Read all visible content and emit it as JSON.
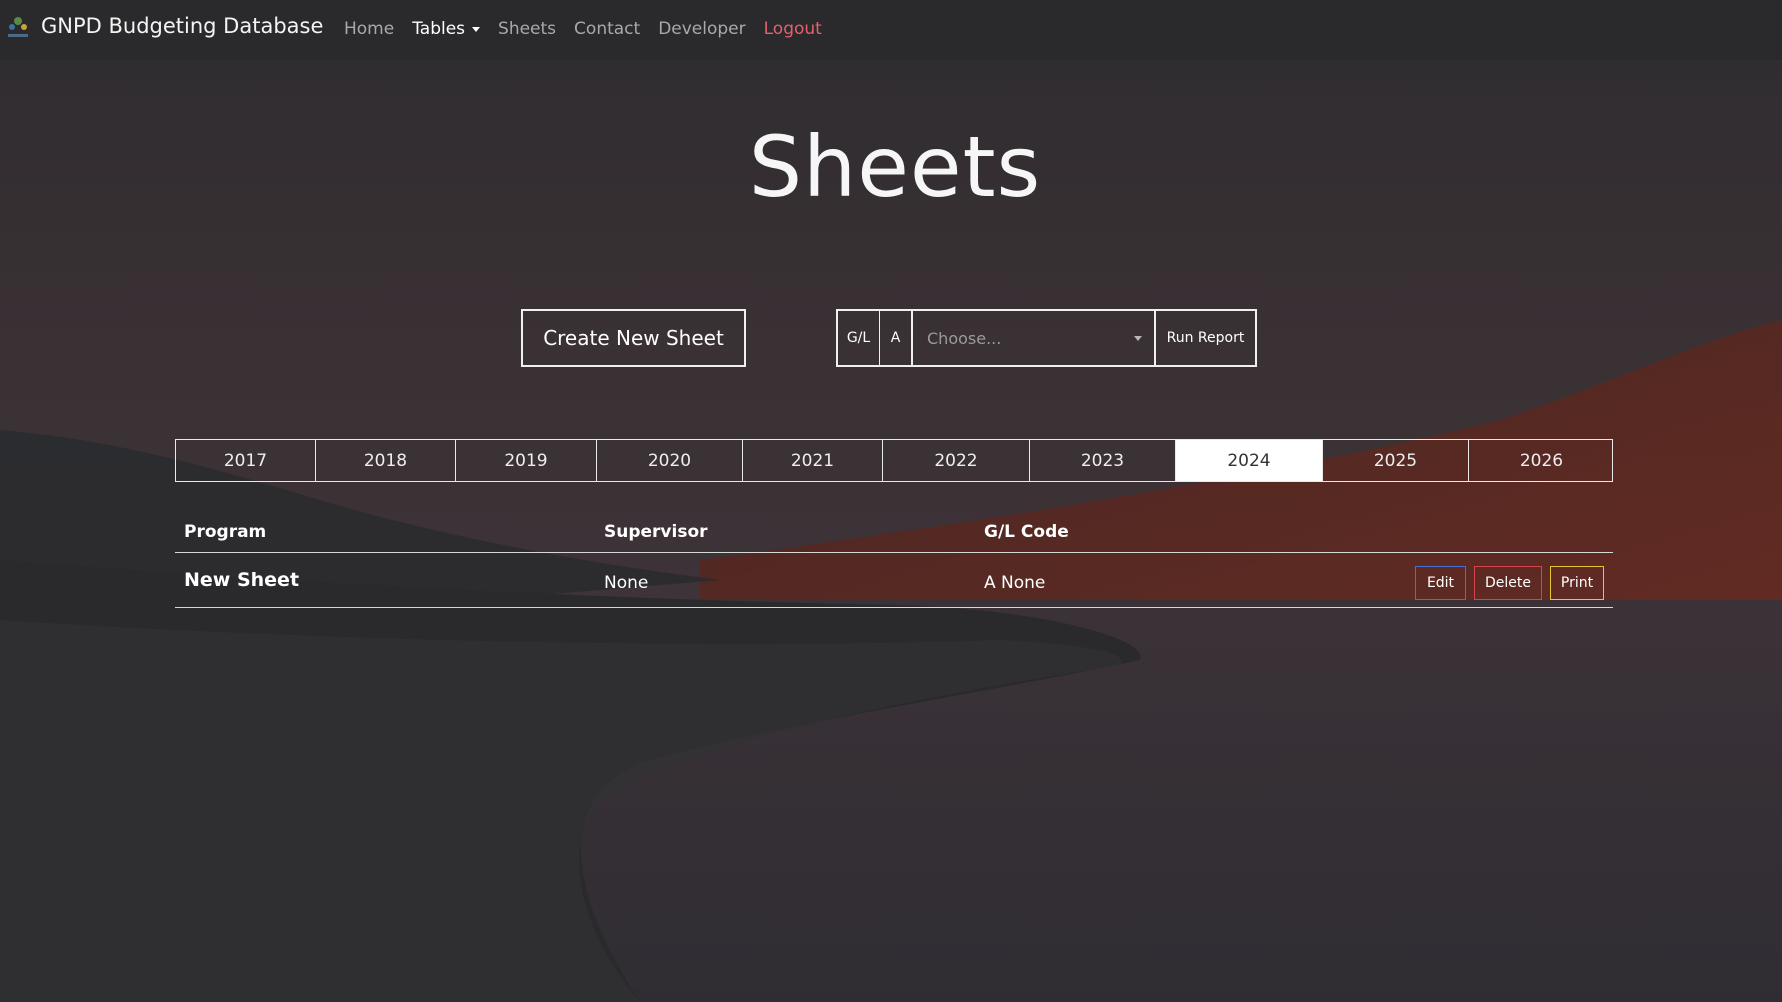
{
  "navbar": {
    "brand": "GNPD Budgeting Database",
    "links": {
      "home": "Home",
      "tables": "Tables",
      "sheets": "Sheets",
      "contact": "Contact",
      "developer": "Developer",
      "logout": "Logout"
    }
  },
  "page": {
    "title": "Sheets"
  },
  "actions": {
    "create_label": "Create New Sheet"
  },
  "report": {
    "gl_label": "G/L",
    "a_label": "A",
    "select_placeholder": "Choose...",
    "run_label": "Run Report"
  },
  "years": [
    "2017",
    "2018",
    "2019",
    "2020",
    "2021",
    "2022",
    "2023",
    "2024",
    "2025",
    "2026"
  ],
  "active_year": "2024",
  "table": {
    "headers": {
      "program": "Program",
      "supervisor": "Supervisor",
      "gl_code": "G/L Code"
    },
    "rows": [
      {
        "program": "New Sheet",
        "supervisor": "None",
        "gl_code": "A None",
        "edit": "Edit",
        "delete": "Delete",
        "print": "Print"
      }
    ]
  },
  "colors": {
    "edit_border": "#4b6fd1",
    "delete_border": "#d6454f",
    "print_border": "#e5c531",
    "logout": "#e4606d"
  }
}
